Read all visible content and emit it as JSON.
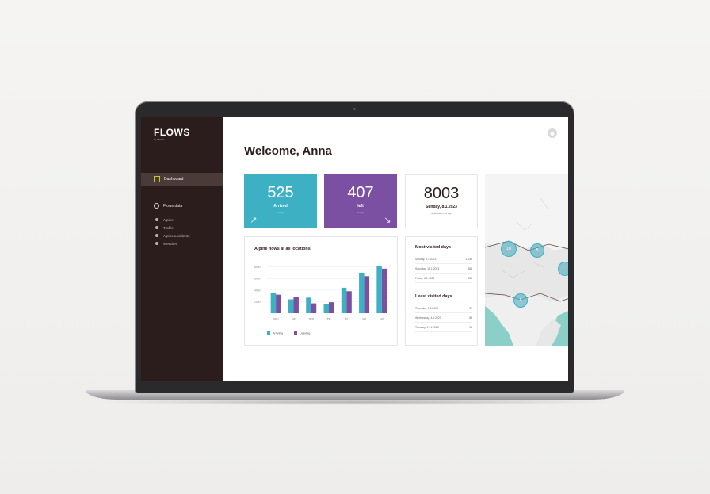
{
  "app": {
    "logo": "FLOWS",
    "logo_sub": "by MIDVA"
  },
  "sidebar": {
    "dashboard_label": "Dashboard",
    "section_label": "Flows data",
    "items": [
      {
        "label": "Alpine"
      },
      {
        "label": "Traffic"
      },
      {
        "label": "Alpine accidents"
      },
      {
        "label": "Weather"
      }
    ]
  },
  "header": {
    "welcome": "Welcome, Anna"
  },
  "stats": {
    "arrived": {
      "value": "525",
      "label": "Arrived",
      "sub": "today",
      "color": "#3db0c4"
    },
    "left": {
      "value": "407",
      "label": "left",
      "sub": "today",
      "color": "#7b4fa1"
    },
    "total": {
      "value": "8003",
      "label": "Sunday, 8.1.2023",
      "sub": "Most visits in a day"
    }
  },
  "chart_data": {
    "type": "bar",
    "title": "Alpine flows at all locations",
    "categories": [
      "mon",
      "tue",
      "wed",
      "thu",
      "fri",
      "sat",
      "sun"
    ],
    "series": [
      {
        "name": "Arriving",
        "color": "#3db0c4",
        "values": [
          3500,
          2400,
          2700,
          1600,
          4400,
          7000,
          8200
        ]
      },
      {
        "name": "Leaving",
        "color": "#7b4fa1",
        "values": [
          3200,
          2800,
          1700,
          1900,
          3800,
          6400,
          7700
        ]
      }
    ],
    "yticks": [
      "8000",
      "6000",
      "4000",
      "2000"
    ],
    "ylim": [
      0,
      8500
    ]
  },
  "most_visited": {
    "title": "Most visited days",
    "rows": [
      {
        "date": "Sunday, 8.1.2023",
        "value": "1,045"
      },
      {
        "date": "Saturday, 14.1.2023",
        "value": "884"
      },
      {
        "date": "Friday, 6.1.2023",
        "value": "863"
      }
    ]
  },
  "least_visited": {
    "title": "Least visited days",
    "rows": [
      {
        "date": "Thursday, 5.1.2023",
        "value": "67"
      },
      {
        "date": "Wednesday, 4.1.2023",
        "value": "83"
      },
      {
        "date": "Tuesday, 17.1.2023",
        "value": "91"
      }
    ]
  },
  "map": {
    "clusters": [
      {
        "label": "10"
      },
      {
        "label": "5"
      },
      {
        "label": "6"
      }
    ]
  }
}
